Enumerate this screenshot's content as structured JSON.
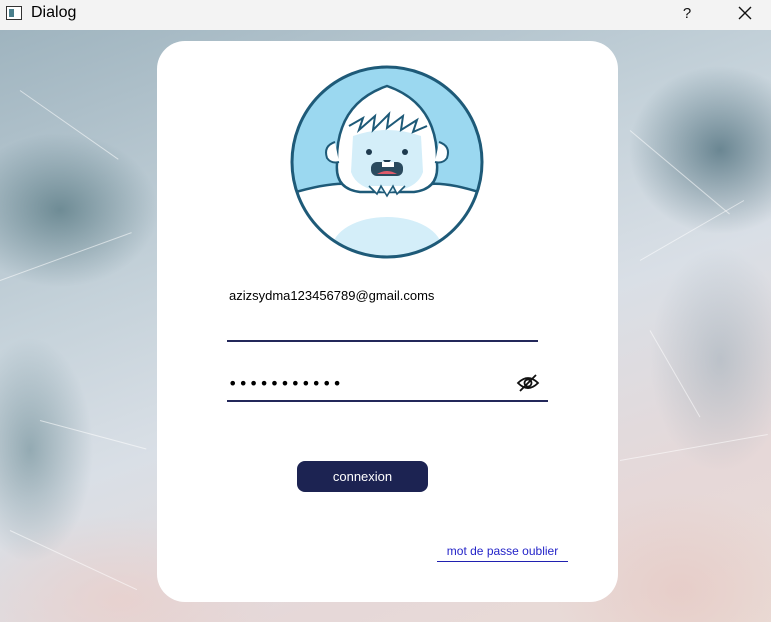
{
  "window": {
    "title": "Dialog",
    "help_label": "?",
    "app_icon": "window-icon",
    "close_icon": "close-icon"
  },
  "login": {
    "email_value": "azizsydma123456789@gmail.coms",
    "password_value": "•••••••••••",
    "password_toggle_icon": "eye-slash-icon",
    "submit_label": "connexion",
    "forgot_label": "mot de passe oublier",
    "avatar_icon": "yeti-avatar-icon"
  },
  "colors": {
    "button_bg": "#1c2352",
    "underline": "#23285a",
    "link": "#2323c8",
    "avatar_circle": "#9bd8f0"
  }
}
